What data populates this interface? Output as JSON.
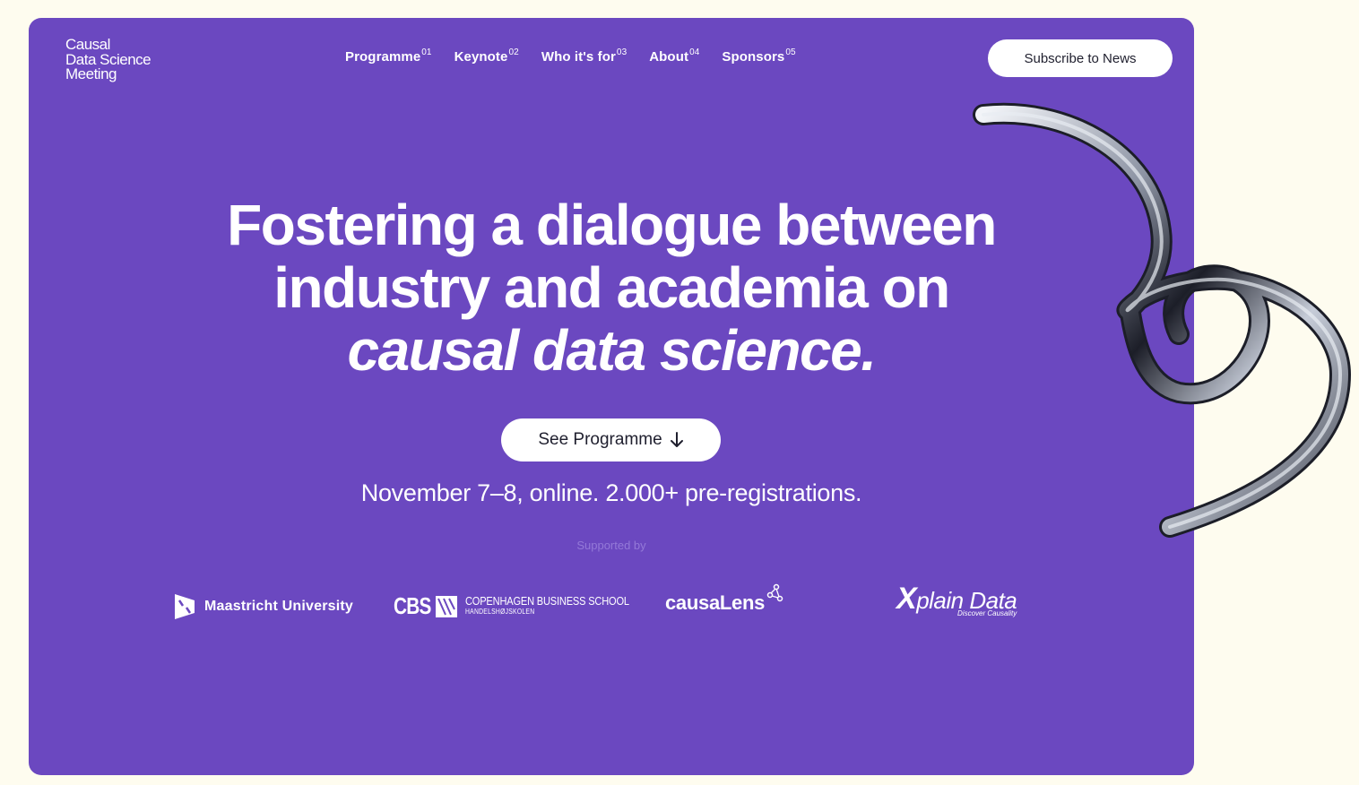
{
  "logo": {
    "lines": [
      "Causal",
      "Data Science",
      "Meeting"
    ]
  },
  "nav": {
    "items": [
      {
        "label": "Programme",
        "num": "01"
      },
      {
        "label": "Keynote",
        "num": "02"
      },
      {
        "label": "Who it's for",
        "num": "03"
      },
      {
        "label": "About",
        "num": "04"
      },
      {
        "label": "Sponsors",
        "num": "05"
      }
    ]
  },
  "header": {
    "subscribe_label": "Subscribe to News"
  },
  "hero": {
    "headline_line1": "Fostering a dialogue between",
    "headline_line2": "industry and academia on",
    "headline_line3": "causal data science.",
    "cta_label": "See Programme",
    "subline": "November 7–8, online. 2.000+ pre-registrations.",
    "supported_by": "Supported by"
  },
  "sponsors": {
    "maastricht": "Maastricht University",
    "cbs_abbr": "CBS",
    "cbs_name": "COPENHAGEN BUSINESS SCHOOL",
    "cbs_sub": "HANDELSHØJSKOLEN",
    "causalens": "causaLens",
    "xplain_x": "X",
    "xplain_name": "plain Data",
    "xplain_tag": "Discover Causality"
  },
  "colors": {
    "background": "#fefcef",
    "hero": "#6b48c0",
    "text": "#ffffff",
    "muted": "#9479d8"
  }
}
